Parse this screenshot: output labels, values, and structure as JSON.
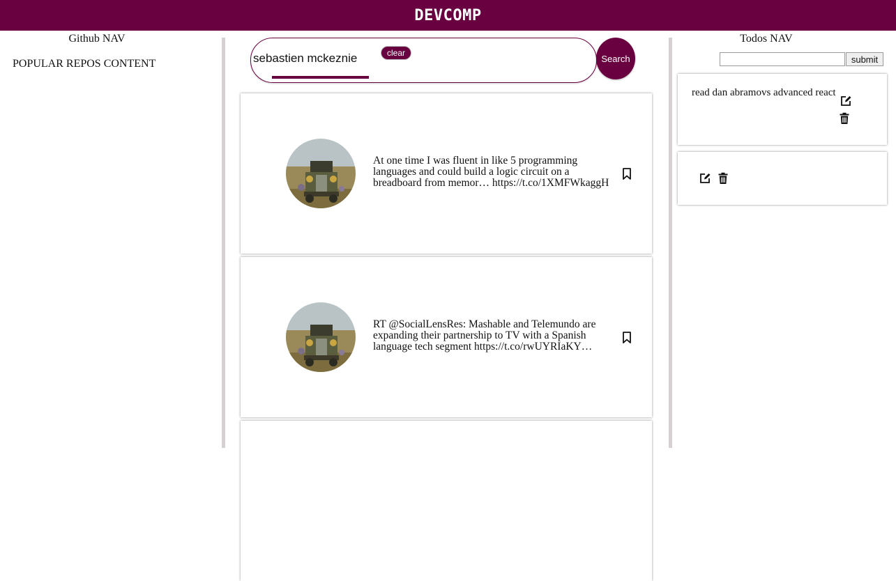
{
  "header": {
    "title": "DEVCOMP"
  },
  "left": {
    "nav_title": "Github NAV",
    "content": "POPULAR REPOS CONTENT"
  },
  "search": {
    "value": "sebastien mckeznie",
    "clear_label": "clear",
    "button_label": "Search"
  },
  "tweets": [
    {
      "text": "At one time I was fluent in like 5 programming languages and could build a logic circuit on a breadboard from memor… https://t.co/1XMFWkaggH",
      "avatar_icon": "truck-photo",
      "bookmark_icon": "bookmark-icon"
    },
    {
      "text": "RT @SocialLensRes: Mashable and Telemundo are expanding their partnership to TV with a Spanish language tech segment https://t.co/rwUYRIaKY…",
      "avatar_icon": "truck-photo",
      "bookmark_icon": "bookmark-icon"
    }
  ],
  "right": {
    "nav_title": "Todos NAV",
    "submit_label": "submit",
    "todo_input_value": "",
    "todos": [
      {
        "text": "read dan abramovs advanced react",
        "edit_icon": "edit-icon",
        "delete_icon": "trash-icon"
      },
      {
        "text": "",
        "edit_icon": "edit-icon",
        "delete_icon": "trash-icon"
      }
    ]
  },
  "colors": {
    "brand": "#69003f",
    "divider": "#d7d0d2"
  }
}
